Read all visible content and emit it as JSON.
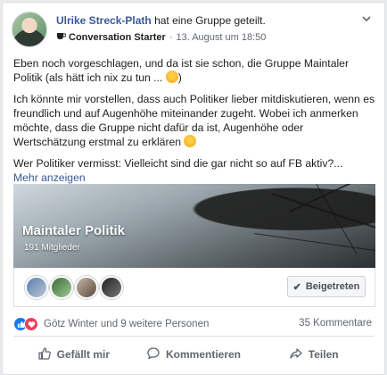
{
  "post": {
    "author": "Ulrike Streck-Plath",
    "action": "hat eine Gruppe geteilt.",
    "badge": "Conversation Starter",
    "separator": "·",
    "timestamp": "13. August um 18:50",
    "paragraph1": "Eben noch vorgeschlagen, und da ist sie schon, die Gruppe Maintaler Politik (als hätt ich nix zu tun ... ",
    "paragraph1_end": ")",
    "paragraph2": "Ich könnte mir vorstellen, dass auch Politiker lieber mitdiskutieren, wenn es freundlich und auf Augenhöhe miteinander zugeht. Wobei ich anmerken möchte, dass die Gruppe nicht dafür da ist, Augenhöhe oder Wertschätzung erstmal zu erklären ",
    "paragraph3": "Wer Politiker vermisst: Vielleicht sind die gar nicht so auf FB aktiv?...",
    "more_link": "Mehr anzeigen"
  },
  "group": {
    "name": "Maintaler Politik",
    "members": "191 Mitglieder",
    "joined_label": "Beigetreten"
  },
  "reactions": {
    "names": "Götz Winter und 9 weitere Personen",
    "comments": "35 Kommentare"
  },
  "actions": {
    "like": "Gefällt mir",
    "comment": "Kommentieren",
    "share": "Teilen"
  },
  "colors": {
    "link": "#385898",
    "like_blue": "#1877f2",
    "love_red": "#f33e58"
  },
  "icons": [
    "chevron-down-icon",
    "coffee-icon",
    "check-icon",
    "like-icon",
    "love-icon",
    "thumbs-up-icon",
    "comment-icon",
    "share-icon"
  ]
}
